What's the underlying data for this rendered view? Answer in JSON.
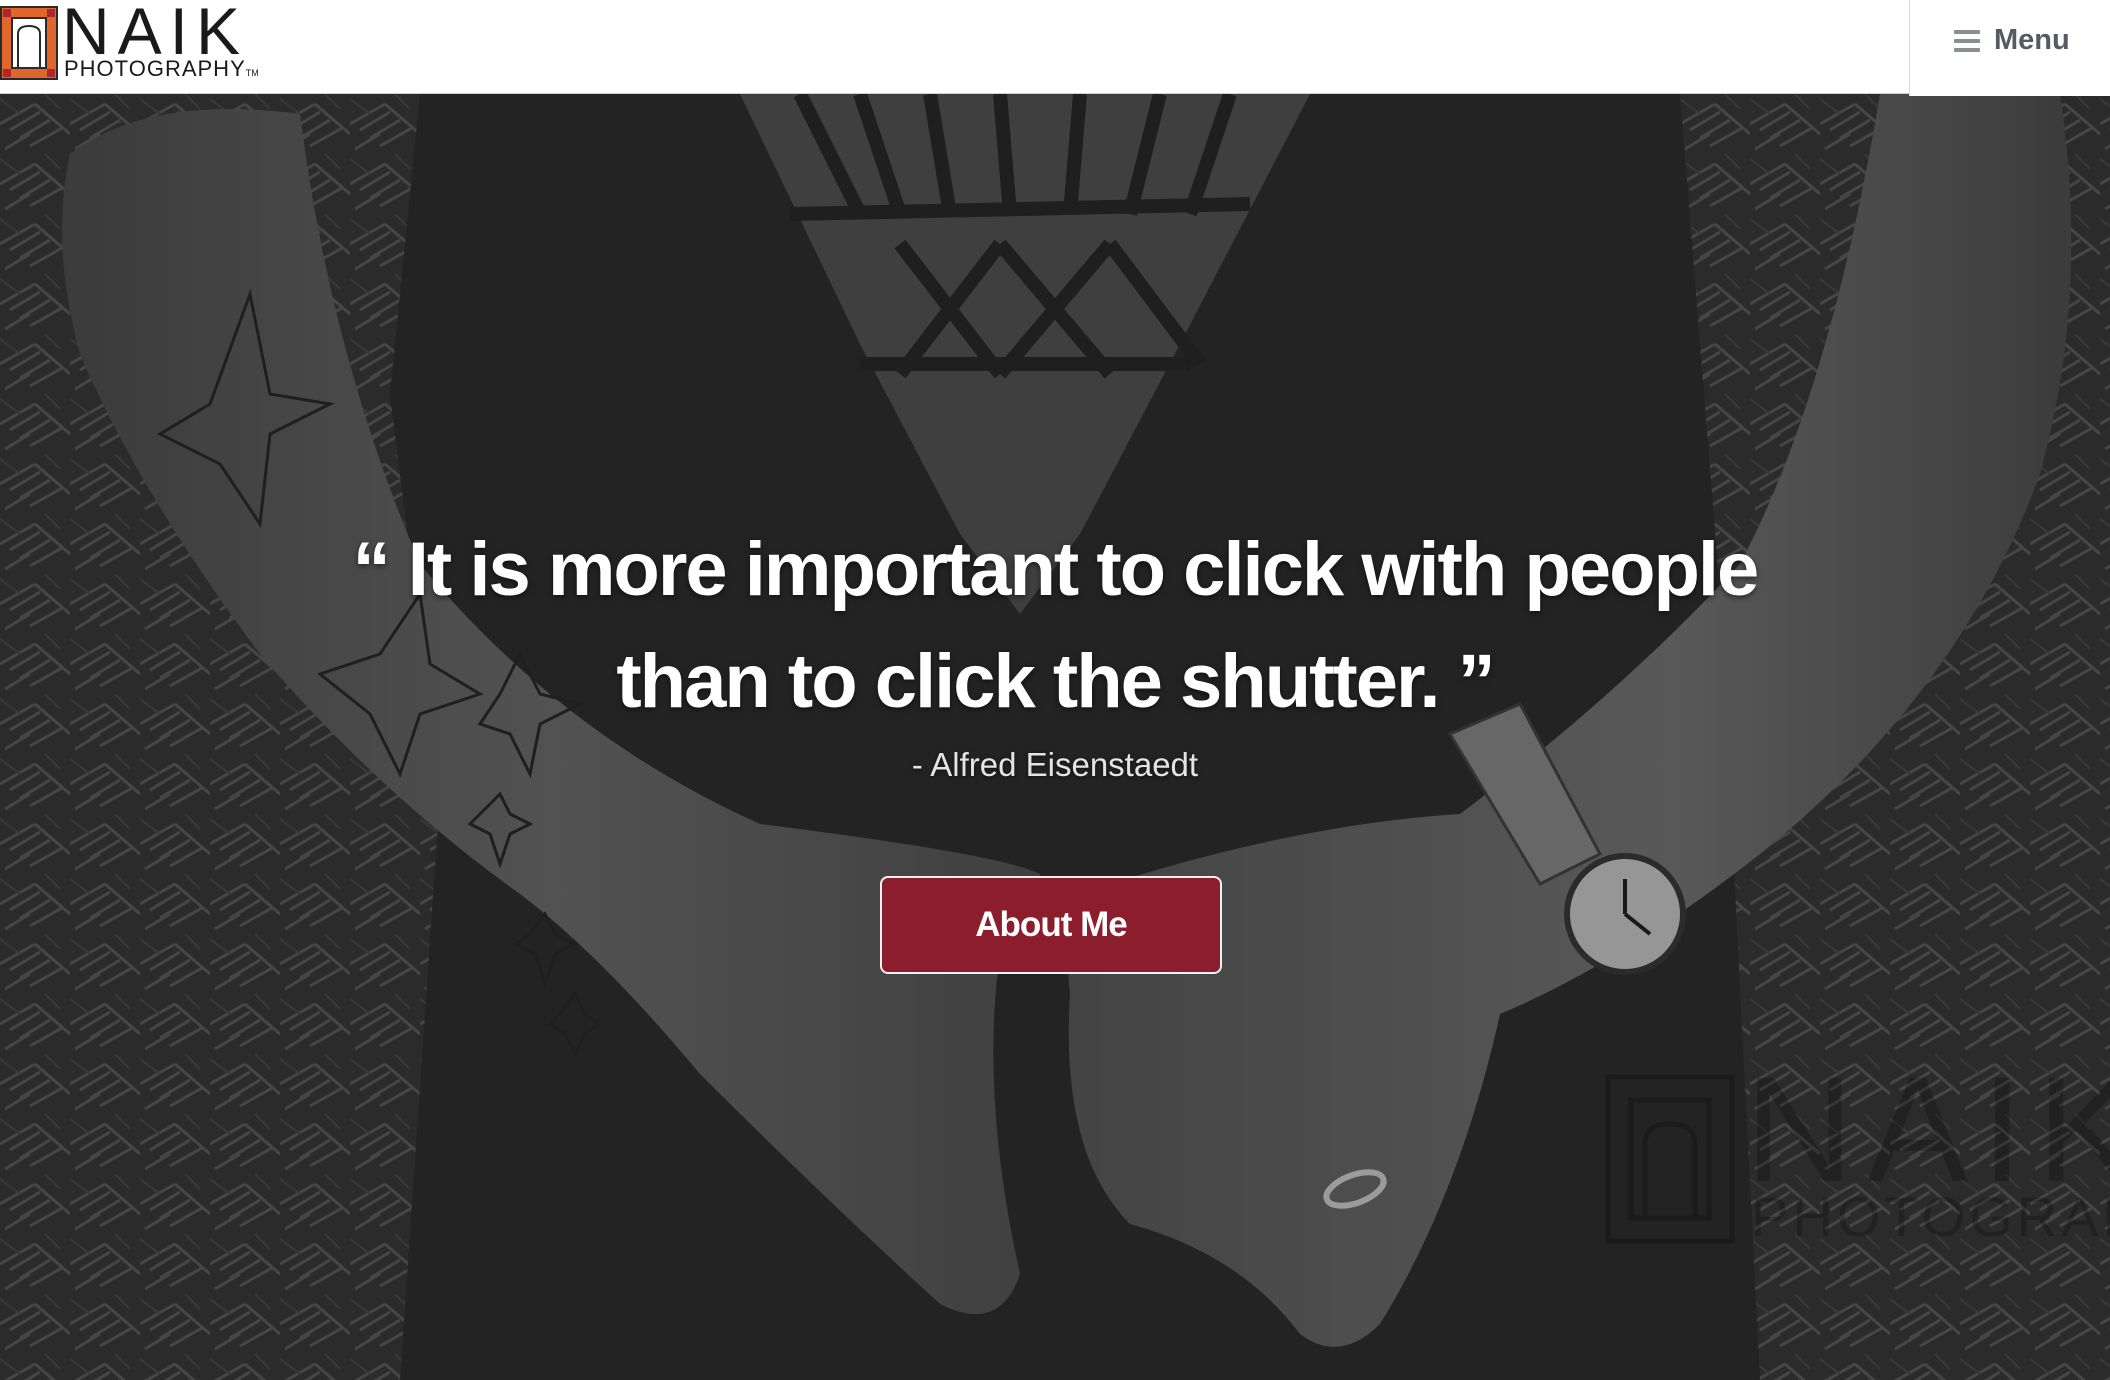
{
  "header": {
    "brand_word": "NAIK",
    "brand_sub": "PHOTOGRAPHY",
    "brand_tm": "TM",
    "menu_icon": "hamburger-icon",
    "menu_label": "Menu"
  },
  "hero": {
    "quote_line1": "“ It is more important to click with people",
    "quote_line2": "than to click the shutter. ”",
    "author": "- Alfred Eisenstaedt",
    "cta_label": "About Me",
    "watermark_word": "NAIK",
    "watermark_sub": "PHOTOGRAPHY"
  },
  "colors": {
    "accent": "#8b1d2c",
    "logo_orange": "#e0672a",
    "logo_red": "#b1262c",
    "menu_text": "#555b60"
  }
}
